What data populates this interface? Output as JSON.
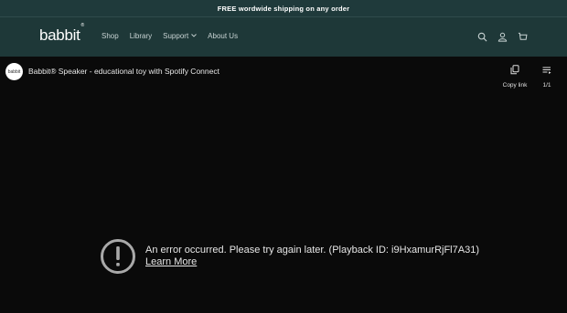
{
  "announcement": "FREE wordwide shipping on any order",
  "header": {
    "logo": "babbit",
    "logo_mark": "®",
    "nav": [
      {
        "label": "Shop"
      },
      {
        "label": "Library"
      },
      {
        "label": "Support",
        "has_dropdown": true
      },
      {
        "label": "About Us"
      }
    ],
    "icons": [
      "search-icon",
      "account-icon",
      "cart-icon"
    ]
  },
  "video": {
    "channel_avatar_text": "babbit",
    "title": "Babbit® Speaker - educational toy with Spotify Connect",
    "copy_link_label": "Copy link",
    "playlist_counter": "1/1",
    "error_message": "An error occurred. Please try again later. (Playback ID: i9HxamurRjFl7A31)",
    "learn_more": "Learn More"
  },
  "colors": {
    "header_bg": "#1e3838",
    "announce_bg": "#1f3a3b",
    "player_bg": "#0a0a0a"
  }
}
